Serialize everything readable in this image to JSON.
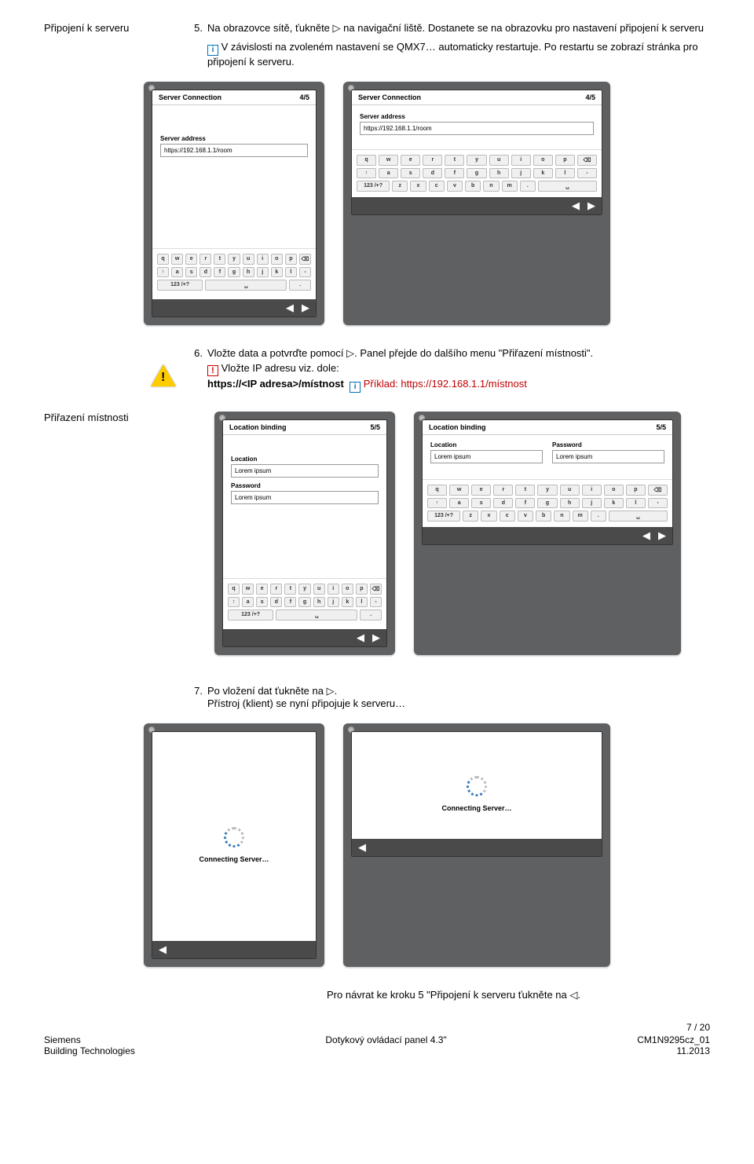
{
  "sections": {
    "s1_title": "Připojení k serveru",
    "s2_title": "Přiřazení místnosti"
  },
  "step5": {
    "num": "5.",
    "text_a": "Na obrazovce sítě, ťukněte ",
    "tri": "▷",
    "text_b": " na navigační liště. Dostanete se na obrazovku pro nastavení připojení k serveru",
    "info": "V závislosti na zvoleném nastavení se QMX7… automaticky restartuje. Po restartu se zobrazí stránka pro připojení k serveru."
  },
  "step6": {
    "num": "6.",
    "text_a": "Vložte data a potvrďte pomocí ",
    "tri": "▷",
    "text_b": ". Panel přejde do dalšího menu \"Přiřazení místnosti\".",
    "warn_line": "Vložte IP adresu viz. dole:",
    "code_line": "https://<IP adresa>/místnost",
    "example_prefix": "Příklad: ",
    "example_url": "https://192.168.1.1/místnost"
  },
  "step7": {
    "num": "7.",
    "text_a": "Po vložení dat ťukněte na ",
    "tri": "▷",
    "text_b": ".",
    "line2": "Přístroj (klient) se nyní připojuje k serveru…"
  },
  "after7": {
    "text_a": "Pro návrat ke kroku 5 \"Připojení k serveru ťukněte na ",
    "tri": "◁",
    "text_b": "."
  },
  "mock_server": {
    "title": "Server Connection",
    "step": "4/5",
    "field_label": "Server address",
    "field_value": "https://192.168.1.1/room"
  },
  "mock_location": {
    "title": "Location binding",
    "step": "5/5",
    "label_loc": "Location",
    "val_loc": "Lorem ipsum",
    "label_pwd": "Password",
    "val_pwd": "Lorem ipsum"
  },
  "mock_connecting": {
    "text": "Connecting Server…"
  },
  "keyboard": {
    "r1": [
      "q",
      "w",
      "e",
      "r",
      "t",
      "y",
      "u",
      "i",
      "o",
      "p",
      "⌫"
    ],
    "r2": [
      "↑",
      "a",
      "s",
      "d",
      "f",
      "g",
      "h",
      "j",
      "k",
      "l",
      "-"
    ],
    "r3": [
      "123 /+?",
      "z",
      "x",
      "c",
      "v",
      "b",
      "n",
      "m",
      ".",
      "␣"
    ],
    "r3_p_a": "123 /+?",
    "r3_p_b": "␣",
    "r3_p_c": "."
  },
  "nav": {
    "left": "◀",
    "right": "▶"
  },
  "footer": {
    "page": "7 / 20",
    "left1": "Siemens",
    "left2": "Building Technologies",
    "center": "Dotykový ovládací panel 4.3\"",
    "right1": "CM1N9295cz_01",
    "right2": "11.2013"
  }
}
